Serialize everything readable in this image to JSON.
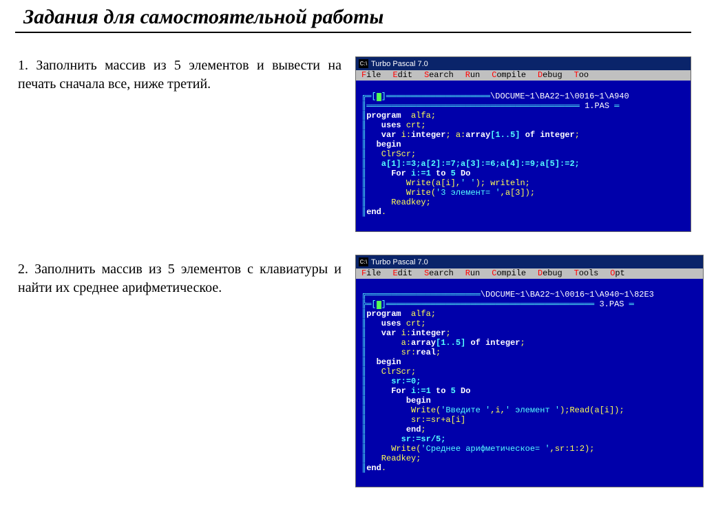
{
  "page_title": "Задания для самостоятельной работы",
  "task1": "1. Заполнить массив из 5 элементов и вывести на печать сначала все, ниже третий.",
  "task2": "2. Заполнить массив из 5 элементов с клавиатуры и найти их среднее арифметическое.",
  "tp": {
    "title": "Turbo Pascal 7.0",
    "cmd_icon": "C:\\",
    "menu": [
      {
        "hot": "F",
        "rest": "ile"
      },
      {
        "hot": "E",
        "rest": "dit"
      },
      {
        "hot": "S",
        "rest": "earch"
      },
      {
        "hot": "R",
        "rest": "un"
      },
      {
        "hot": "C",
        "rest": "ompile"
      },
      {
        "hot": "D",
        "rest": "ebug"
      },
      {
        "hot": "T",
        "rest": "oo"
      }
    ],
    "menu2": [
      {
        "hot": "F",
        "rest": "ile"
      },
      {
        "hot": "E",
        "rest": "dit"
      },
      {
        "hot": "S",
        "rest": "earch"
      },
      {
        "hot": "R",
        "rest": "un"
      },
      {
        "hot": "C",
        "rest": "ompile"
      },
      {
        "hot": "D",
        "rest": "ebug"
      },
      {
        "hot": "T",
        "rest": "ools"
      },
      {
        "hot": "O",
        "rest": "pt"
      }
    ],
    "path1_left": "═════════════════════════════",
    "path1": "\\DOCUME~1\\BA22~1\\0016~1\\A940",
    "path2": "\\DOCUME~1\\BA22~1\\0016~1\\A940~1\\82E3",
    "file1": "1.PAS",
    "file2": "3.PAS"
  },
  "code1": {
    "l01": "program",
    "l01b": "  alfa;",
    "l02": "   uses",
    "l02b": " crt;",
    "l03": "   var",
    "l03b": " i:",
    "l03c": "integer",
    "l03d": "; a:",
    "l03e": "array",
    "l03f": "[1..5] ",
    "l03g": "of",
    "l03h": " ",
    "l03i": "integer",
    "l03j": ";",
    "l04": "  begin",
    "l05": "   ClrScr;",
    "l06": "   a[1]:=3;a[2]:=7;a[3]:=6;a[4]:=9;a[5]:=2;",
    "l07a": "     For",
    "l07b": " i:=1 ",
    "l07c": "to",
    "l07d": " 5 ",
    "l07e": "Do",
    "l08": "        Write(a[i],",
    "l08b": "' '",
    "l08c": "); writeln;",
    "l09": "        Write(",
    "l09b": "'3 элемент= '",
    "l09c": ",a[3]);",
    "l10": "     Readkey;",
    "l11": "end",
    "l11b": "."
  },
  "code2": {
    "l01": "program",
    "l01b": "  alfa;",
    "l02": "   uses",
    "l02b": " crt;",
    "l03": "   var",
    "l03b": " i:",
    "l03c": "integer",
    "l03d": ";",
    "l04": "       a:",
    "l04b": "array",
    "l04c": "[1..5] ",
    "l04d": "of",
    "l04e": " ",
    "l04f": "integer",
    "l04g": ";",
    "l05": "       sr:",
    "l05b": "real",
    "l05c": ";",
    "l06": "  begin",
    "l07": "   ClrScr;",
    "l08": "     sr:=0;",
    "l09a": "     For",
    "l09b": " i:=1 ",
    "l09c": "to",
    "l09d": " 5 ",
    "l09e": "Do",
    "l10": "        begin",
    "l11": "         Write(",
    "l11b": "'Введите '",
    "l11c": ",i,",
    "l11d": "' элемент '",
    "l11e": ");Read(a[i]);",
    "l12": "         sr:=sr+a[i]",
    "l13": "        end",
    "l13b": ";",
    "l14": "       sr:=sr/5;",
    "l15": "     Write(",
    "l15b": "'Среднее арифметическое= '",
    "l15c": ",sr:1:2);",
    "l16": "   Readkey;",
    "l17": "end",
    "l17b": "."
  }
}
